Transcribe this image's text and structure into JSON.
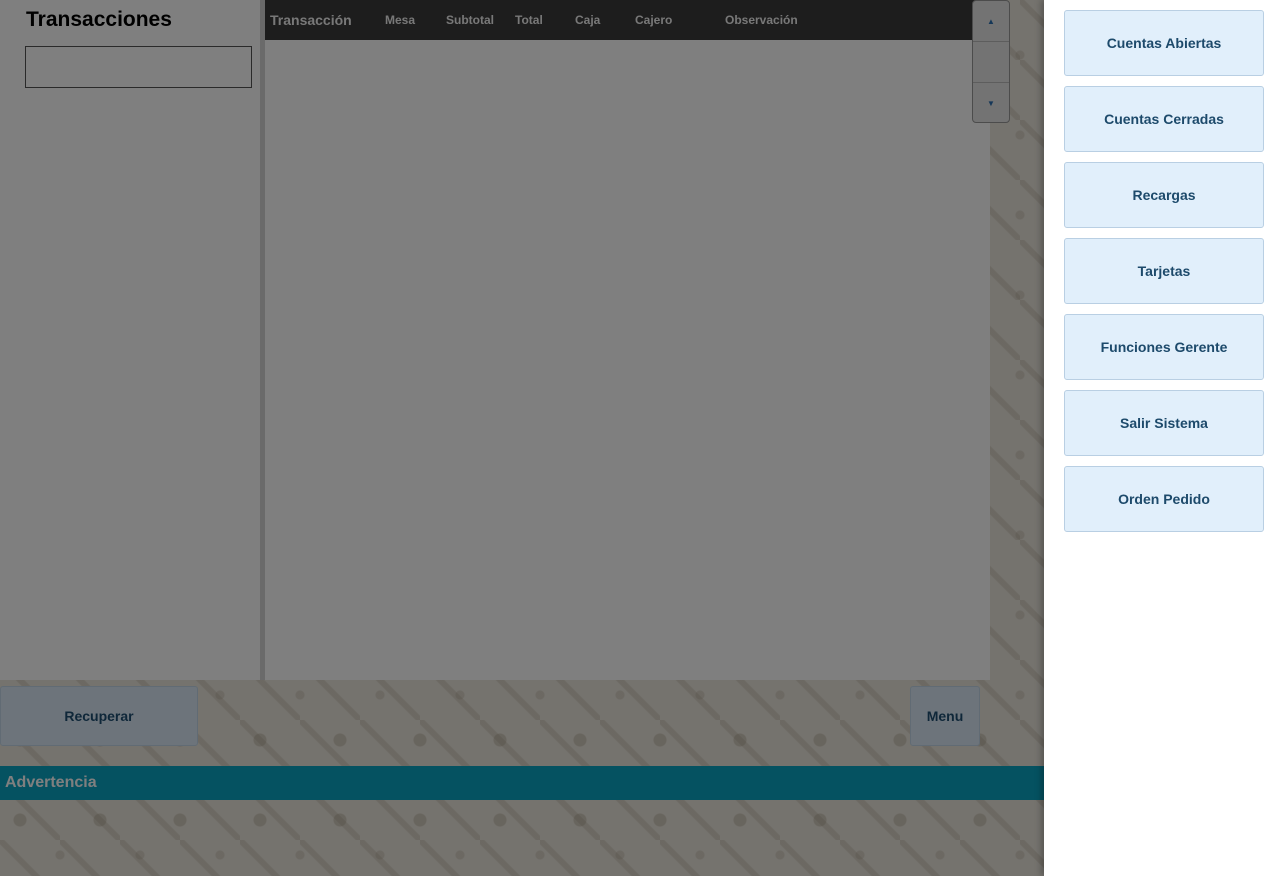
{
  "transactions_panel": {
    "title": "Transacciones",
    "search_value": ""
  },
  "grid": {
    "columns": [
      "Transacción",
      "Mesa",
      "Subtotal",
      "Total",
      "Caja",
      "Cajero",
      "Observación"
    ],
    "rows": []
  },
  "scroll": {
    "up_icon": "triangle-up-icon",
    "down_icon": "triangle-down-icon"
  },
  "actions": {
    "recuperar_label": "Recuperar",
    "menu_label": "Menu"
  },
  "warning": {
    "label": "Advertencia"
  },
  "side_menu": {
    "items": [
      {
        "label": "Cuentas Abiertas"
      },
      {
        "label": "Cuentas Cerradas"
      },
      {
        "label": "Recargas"
      },
      {
        "label": "Tarjetas"
      },
      {
        "label": "Funciones Gerente"
      },
      {
        "label": "Salir Sistema"
      },
      {
        "label": "Orden Pedido"
      }
    ]
  },
  "colors": {
    "header_bg": "#3a3a3a",
    "warning_bar": "#0ba4c2",
    "button_bg": "#e1effb",
    "button_text": "#1d4a6b"
  }
}
